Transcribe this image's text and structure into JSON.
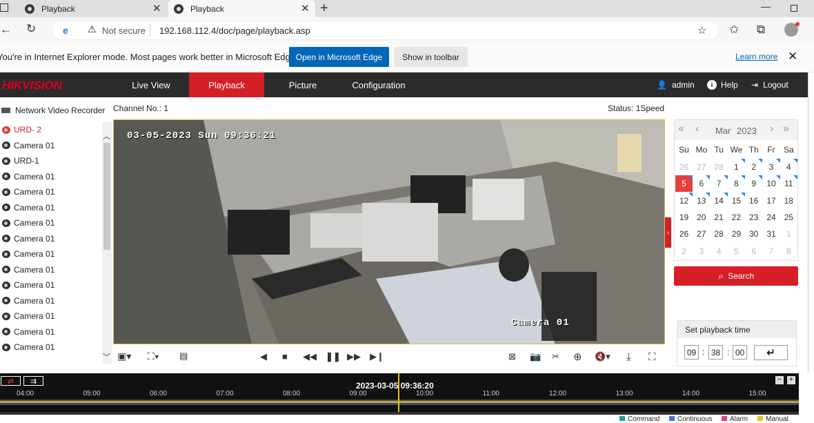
{
  "browser": {
    "tabs": [
      {
        "label": "Playback"
      },
      {
        "label": "Playback"
      }
    ],
    "security": "Not secure",
    "url": "192.168.112.4/doc/page/playback.asp"
  },
  "ie_bar": {
    "message": "You're in Internet Explorer mode. Most pages work better in Microsoft Edge.",
    "open_edge": "Open in Microsoft Edge",
    "show_toolbar": "Show in toolbar",
    "learn_more": "Learn more"
  },
  "app": {
    "logo": "HIKVISION",
    "nav": [
      "Live View",
      "Playback",
      "Picture",
      "Configuration"
    ],
    "user": "admin",
    "help": "Help",
    "logout": "Logout"
  },
  "tree": {
    "root": "Network Video Recorder",
    "items": [
      "URD- 2",
      "Camera 01",
      "URD-1",
      "Camera 01",
      "Camera 01",
      "Camera 01",
      "Camera 01",
      "Camera 01",
      "Camera 01",
      "Camera 01",
      "Camera 01",
      "Camera 01",
      "Camera 01",
      "Camera 01",
      "Camera 01"
    ]
  },
  "player": {
    "channel": "Channel No.: 1",
    "status": "Status: 1Speed",
    "osd_timestamp": "03-05-2023 Sun 09:36:21",
    "osd_camera": "Camera 01"
  },
  "calendar": {
    "month": "Mar",
    "year": "2023",
    "weekdays": [
      "Su",
      "Mo",
      "Tu",
      "We",
      "Th",
      "Fr",
      "Sa"
    ],
    "days": [
      "26",
      "27",
      "28",
      "1",
      "2",
      "3",
      "4",
      "5",
      "6",
      "7",
      "8",
      "9",
      "10",
      "11",
      "12",
      "13",
      "14",
      "15",
      "16",
      "17",
      "18",
      "19",
      "20",
      "21",
      "22",
      "23",
      "24",
      "25",
      "26",
      "27",
      "28",
      "29",
      "30",
      "31",
      "1",
      "2",
      "3",
      "4",
      "5",
      "6",
      "7",
      "8"
    ],
    "selected_day": "5",
    "search_label": "Search"
  },
  "playback_time": {
    "title": "Set playback time",
    "hh": "09",
    "mm": "38",
    "ss": "00",
    "sep": ":"
  },
  "timeline": {
    "current": "2023-03-05 09:36:20",
    "hours": [
      "04:00",
      "05:00",
      "06:00",
      "07:00",
      "08:00",
      "09:00",
      "10:00",
      "11:00",
      "12:00",
      "13:00",
      "14:00",
      "15:00"
    ],
    "legend": [
      {
        "label": "Command",
        "color": "#1aa39a"
      },
      {
        "label": "Continuous",
        "color": "#4a6cd8"
      },
      {
        "label": "Alarm",
        "color": "#e0406e"
      },
      {
        "label": "Manual",
        "color": "#e8c21a"
      }
    ]
  },
  "colors": {
    "brand_red": "#d41f26",
    "edge_blue": "#0067b8",
    "record_blue": "#2b8ee8"
  }
}
